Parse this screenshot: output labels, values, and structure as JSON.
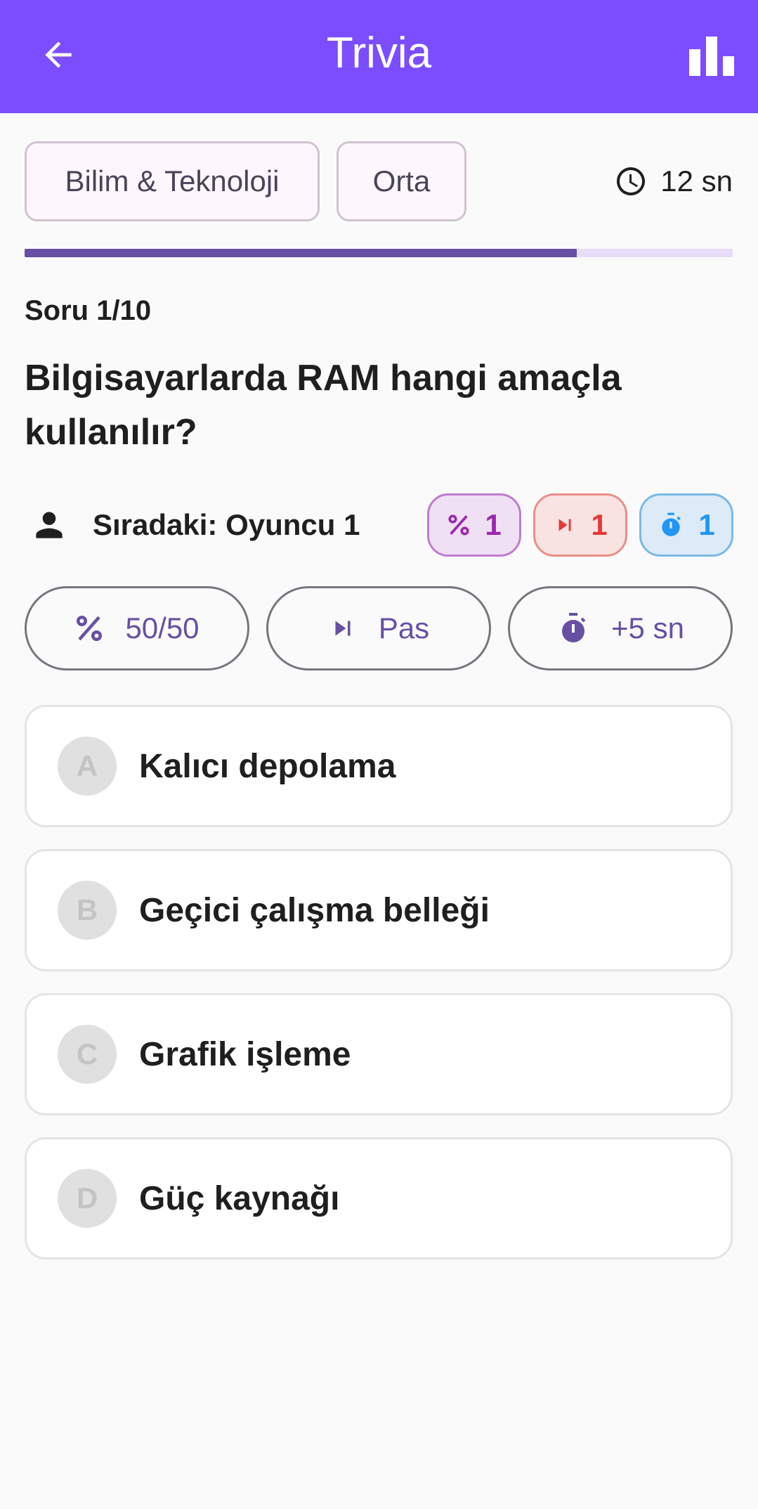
{
  "appbar": {
    "title": "Trivia",
    "back_icon": "arrow-back-icon",
    "stats_icon": "bar-chart-icon"
  },
  "colors": {
    "primary": "#7c4dff",
    "accent": "#6750a4",
    "fifty": "#9c27b0",
    "pass": "#e53935",
    "time": "#2196f3"
  },
  "chips": {
    "category": "Bilim & Teknoloji",
    "difficulty": "Orta"
  },
  "timer": {
    "icon": "clock-icon",
    "text": "12 sn"
  },
  "progress": {
    "fraction": 0.78
  },
  "question": {
    "label": "Soru 1/10",
    "text": "Bilgisayarlarda RAM hangi amaçla kullanılır?"
  },
  "player": {
    "icon": "person-icon",
    "text": "Sıradaki: Oyuncu 1"
  },
  "badges": [
    {
      "icon": "percent-icon",
      "count": "1"
    },
    {
      "icon": "skip-next-icon",
      "count": "1"
    },
    {
      "icon": "timer-icon",
      "count": "1"
    }
  ],
  "lifelines": [
    {
      "icon": "percent-icon",
      "label": "50/50"
    },
    {
      "icon": "skip-next-icon",
      "label": "Pas"
    },
    {
      "icon": "timer-icon",
      "label": "+5 sn"
    }
  ],
  "answers": [
    {
      "letter": "A",
      "text": "Kalıcı depolama"
    },
    {
      "letter": "B",
      "text": "Geçici çalışma belleği"
    },
    {
      "letter": "C",
      "text": "Grafik işleme"
    },
    {
      "letter": "D",
      "text": "Güç kaynağı"
    }
  ]
}
